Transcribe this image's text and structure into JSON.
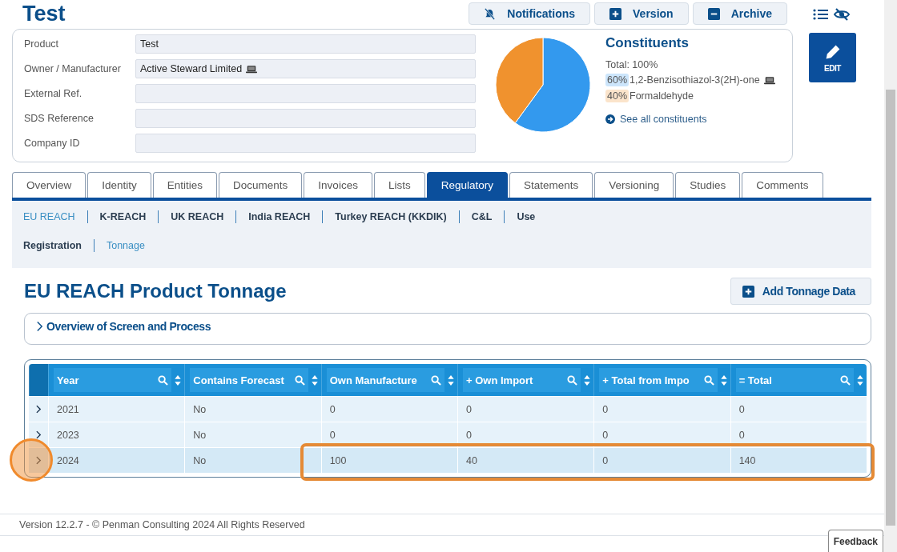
{
  "page_title": "Test",
  "toolbar": {
    "buttons": [
      {
        "label": "Notifications",
        "kind": "bell-off"
      },
      {
        "label": "Version",
        "kind": "add"
      },
      {
        "label": "Archive",
        "kind": "remove"
      }
    ]
  },
  "details": {
    "fields": [
      {
        "label": "Product",
        "value": "Test",
        "device_icon": false
      },
      {
        "label": "Owner / Manufacturer",
        "value": "Active Steward Limited",
        "device_icon": true
      },
      {
        "label": "External Ref.",
        "device_icon": false
      },
      {
        "label": "SDS Reference",
        "device_icon": false
      },
      {
        "label": "Company ID",
        "device_icon": false
      }
    ]
  },
  "constituents": {
    "title": "Constituents",
    "total": "Total: 100%",
    "items": [
      {
        "percent": "60%",
        "device_icon": true,
        "color": "#3399ee"
      },
      {
        "percent": "40%",
        "device_icon": false,
        "color": "#f0922e"
      }
    ],
    "chart_data": {
      "type": "pie",
      "categories": [
        "1,2-Benzisothiazol-3(2H)-one",
        "Formaldehyde"
      ],
      "values": [
        60,
        40
      ]
    },
    "link": "See all constituents"
  },
  "edit_button": "EDIT",
  "tabs": [
    {
      "label": "Overview",
      "selected": false
    },
    {
      "label": "Identity",
      "selected": false
    },
    {
      "label": "Entities",
      "selected": false
    },
    {
      "label": "Documents",
      "selected": false
    },
    {
      "label": "Invoices",
      "selected": false
    },
    {
      "label": "Lists",
      "selected": false
    },
    {
      "label": "Regulatory",
      "selected": true
    },
    {
      "label": "Statements",
      "selected": false
    },
    {
      "label": "Versioning",
      "selected": false
    },
    {
      "label": "Studies",
      "selected": false
    },
    {
      "label": "Comments",
      "selected": false
    }
  ],
  "subnav": {
    "rows": [
      [
        {
          "label": "EU REACH",
          "selected": true
        },
        {
          "label": "K-REACH",
          "selected": false
        },
        {
          "label": "UK REACH",
          "selected": false
        },
        {
          "label": "India REACH",
          "selected": false
        },
        {
          "label": "Turkey REACH (KKDIK)",
          "selected": false
        },
        {
          "label": "C&L",
          "selected": false
        },
        {
          "label": "Use",
          "selected": false
        }
      ],
      [
        {
          "label": "Registration",
          "selected": false
        },
        {
          "label": "Tonnage",
          "selected": true
        }
      ]
    ]
  },
  "section": {
    "title": "EU REACH Product Tonnage",
    "add_button": "Add Tonnage Data",
    "overview": {
      "label": "Overview of Screen and Process",
      "expanded": false
    }
  },
  "table": {
    "columns": [
      "Year",
      "Contains Forecast",
      "Own Manufacture",
      "+ Own Import",
      "+ Total from Impo",
      "= Total"
    ],
    "rows": [
      {
        "cells": [
          "2021",
          "No",
          "0",
          "0",
          "0",
          "0"
        ],
        "selected": false,
        "highlighted": false
      },
      {
        "cells": [
          "2023",
          "No",
          "0",
          "0",
          "0",
          "0"
        ],
        "selected": false,
        "highlighted": false
      },
      {
        "cells": [
          "2024",
          "No",
          "100",
          "40",
          "0",
          "140"
        ],
        "selected": true,
        "highlighted": true
      }
    ]
  },
  "footer": "Version 12.2.7 - © Penman Consulting 2024 All Rights Reserved",
  "feedback_button": "Feedback"
}
